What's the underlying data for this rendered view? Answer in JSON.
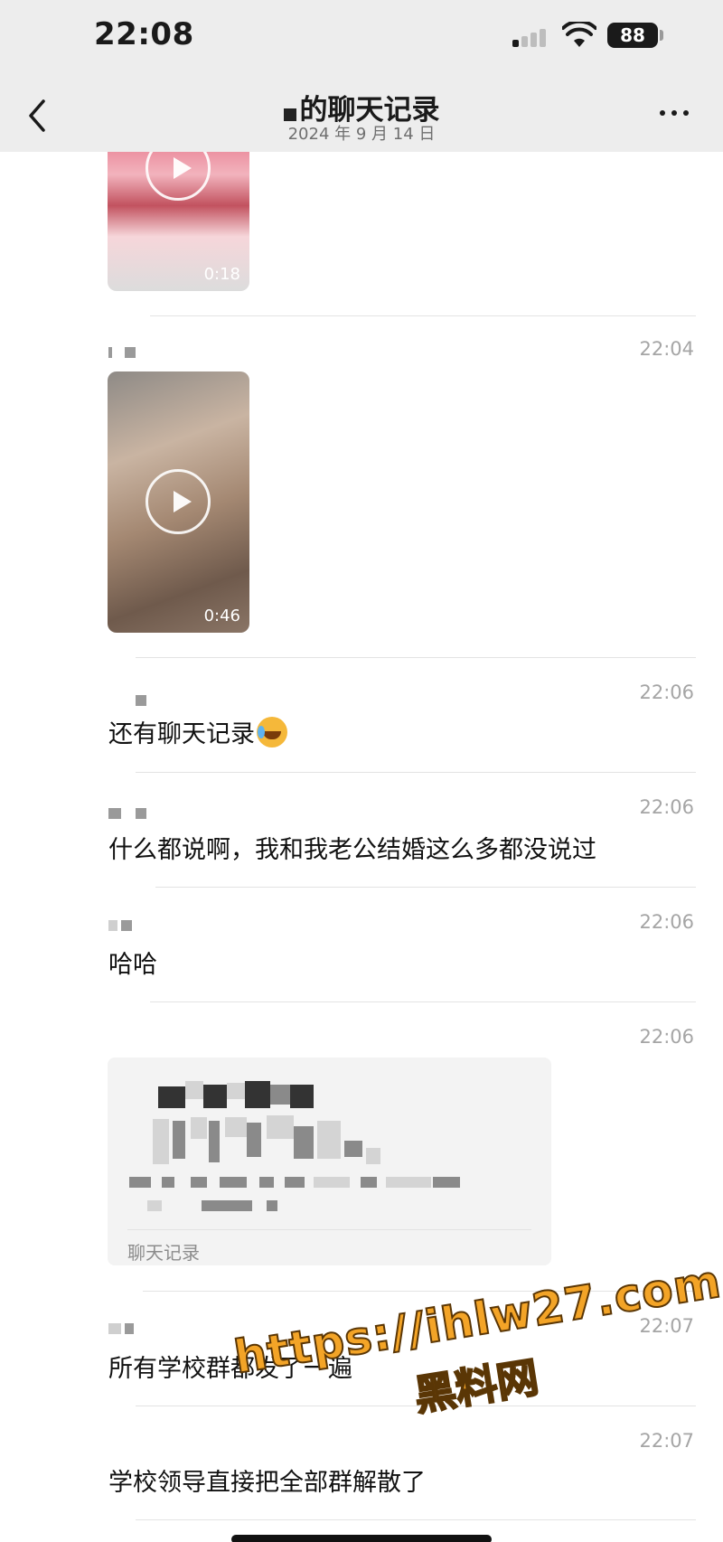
{
  "status_bar": {
    "time": "22:08",
    "battery": "88"
  },
  "nav": {
    "title": "的聊天记录",
    "subtitle": "2024 年 9 月 14 日"
  },
  "videos": [
    {
      "duration": "0:18"
    },
    {
      "duration": "0:46"
    }
  ],
  "messages": [
    {
      "time": "22:04"
    },
    {
      "time": "22:06",
      "text": "还有聊天记录"
    },
    {
      "time": "22:06",
      "text": "什么都说啊，我和我老公结婚这么多都没说过"
    },
    {
      "time": "22:06",
      "text": "哈哈"
    },
    {
      "time": "22:06"
    },
    {
      "time": "22:07",
      "text": "所有学校群都发了一遍"
    },
    {
      "time": "22:07",
      "text": "学校领导直接把全部群解散了"
    }
  ],
  "chat_record_card": {
    "label": "聊天记录"
  },
  "watermark": {
    "url": "https://ihlw27.com",
    "name": "黑料网"
  },
  "colors": {
    "header_bg": "#ededed",
    "divider": "#e3e3e3",
    "timestamp": "#a5a5a5",
    "watermark": "#f3a427"
  }
}
